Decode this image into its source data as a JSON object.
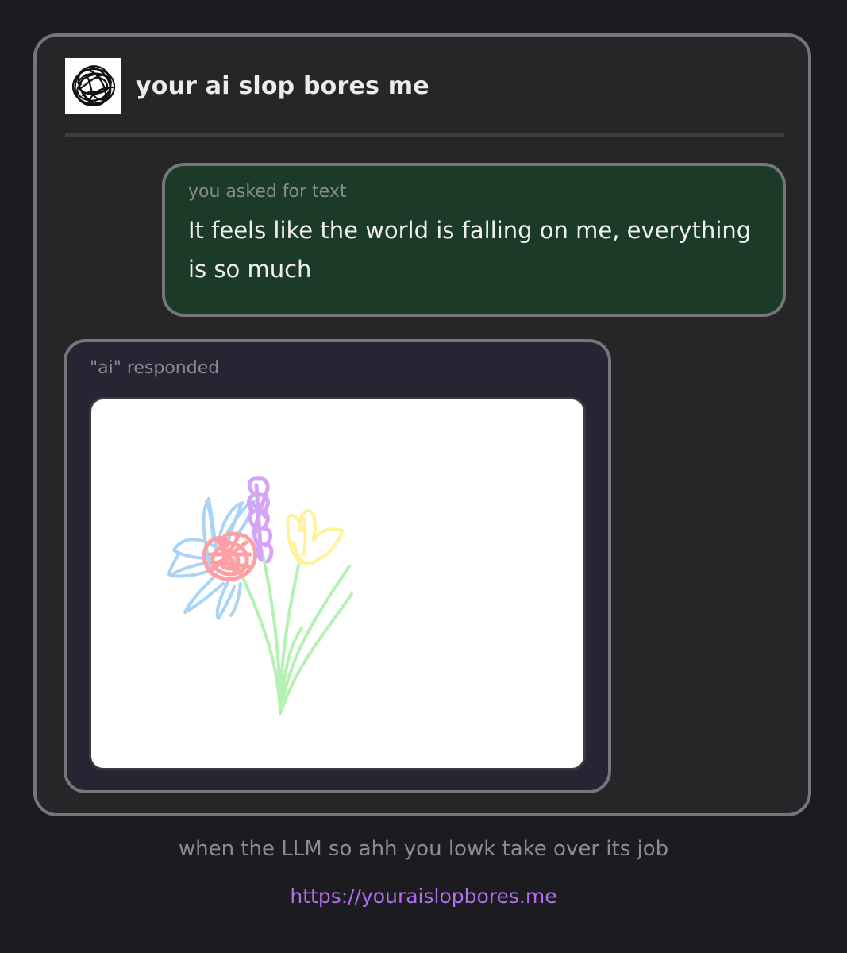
{
  "header": {
    "title": "your ai slop bores me",
    "logo_icon": "scribble-ball-icon"
  },
  "conversation": {
    "user_label": "you asked for text",
    "user_message": "It feels like the world is falling on me, everything is so much",
    "ai_label": "\"ai\" responded",
    "ai_response_image": "hand-drawn-flower-bouquet"
  },
  "footer": {
    "caption": "when the LLM so ahh you lowk take over its job",
    "link": "https://youraislopbores.me"
  },
  "colors": {
    "page_background": "#1c1c20",
    "card_background": "#262628",
    "border": "#75757b",
    "user_bubble": "#1c3a28",
    "ai_bubble": "#282434",
    "link": "#b06ef0",
    "flower_blue": "#a9d4f6",
    "flower_red": "#ff9fa4",
    "flower_purple": "#d6a4f7",
    "flower_yellow": "#fff29a",
    "stem_green": "#b4f2b4"
  }
}
